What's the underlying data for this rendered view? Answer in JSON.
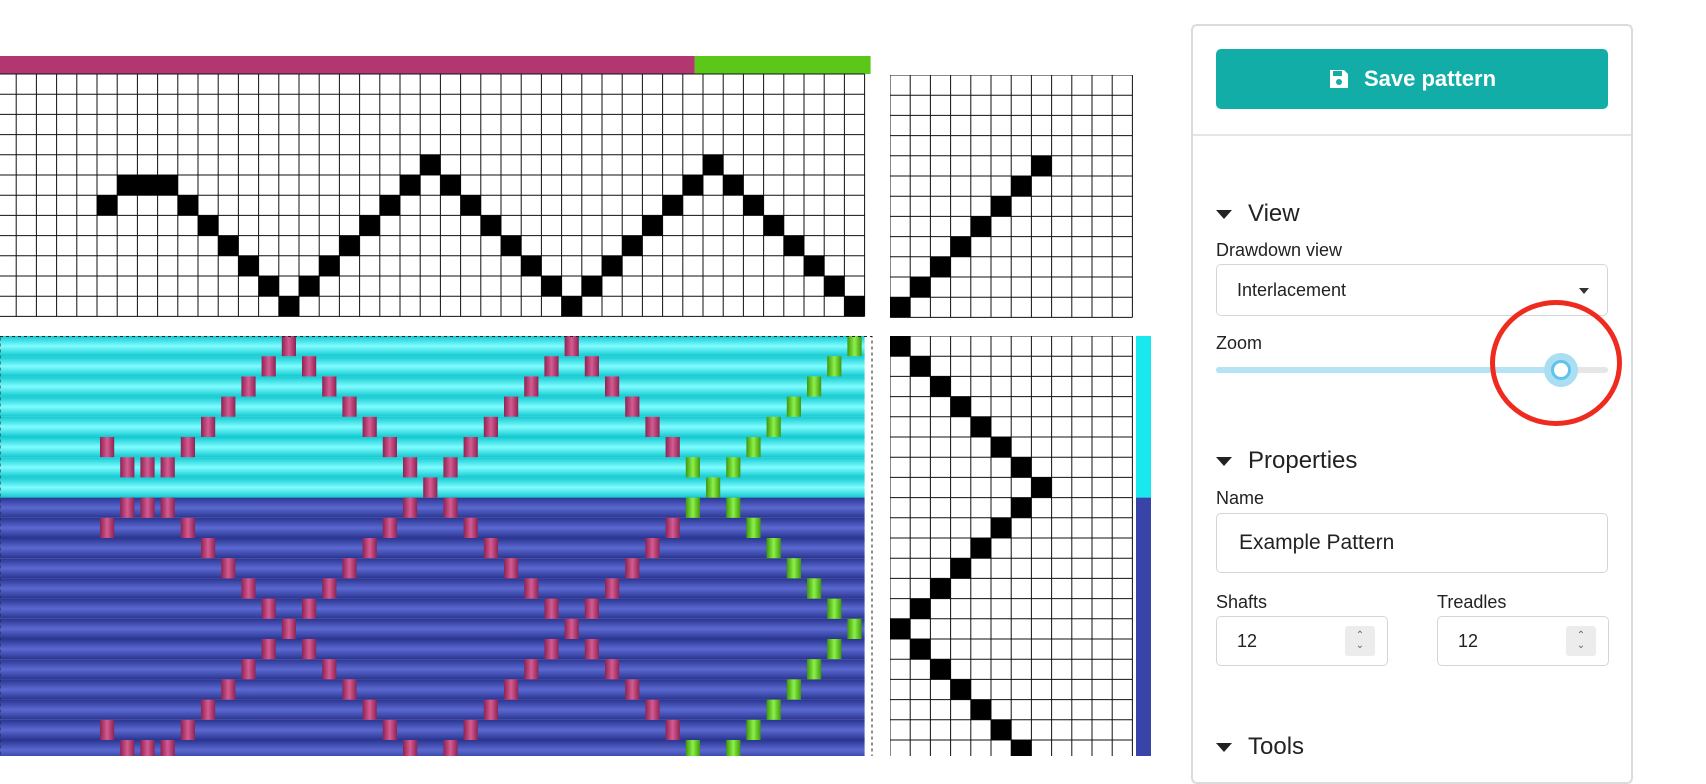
{
  "toolbar": {
    "save_label": "Save pattern",
    "save_icon": "floppy-disk-icon"
  },
  "view_section": {
    "title": "View",
    "drawdown_label": "Drawdown view",
    "drawdown_value": "Interlacement",
    "zoom_label": "Zoom",
    "zoom_fraction": 0.88
  },
  "properties_section": {
    "title": "Properties",
    "name_label": "Name",
    "name_value": "Example Pattern",
    "shafts_label": "Shafts",
    "shafts_value": "12",
    "treadles_label": "Treadles",
    "treadles_value": "12"
  },
  "tools_section": {
    "title": "Tools"
  },
  "colors": {
    "accent": "#13ada8",
    "warp_magenta": "#b2366f",
    "warp_green": "#5ac719",
    "weft_cyan": "#19e9ee",
    "weft_blue": "#3844a8",
    "highlight": "#ef2b1f"
  }
}
